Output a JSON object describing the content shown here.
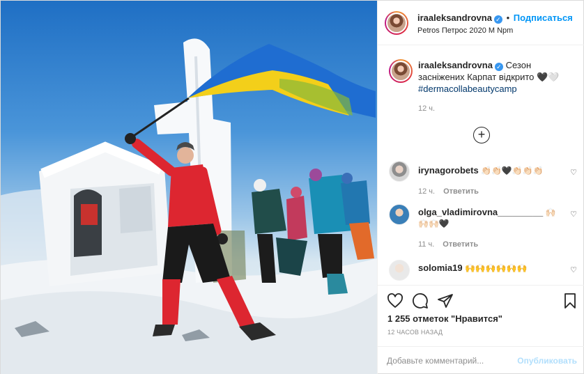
{
  "header": {
    "username": "iraaleksandrovna",
    "dot": "•",
    "follow_label": "Подписаться",
    "location": "Petros Петрос 2020 M Npm"
  },
  "caption": {
    "username": "iraaleksandrovna",
    "text": "Сезон засніжених Карпат відкрито 🖤🤍",
    "hashtag": "#dermacollabeautycamp",
    "age": "12 ч."
  },
  "comments": [
    {
      "username": "irynagorobets",
      "text": "👏🏻👏🏻🖤👏🏻👏🏻👏🏻",
      "age": "12 ч.",
      "reply": "Ответить"
    },
    {
      "username": "olga_vladimirovna_________",
      "text": "🙌🏻🙌🏻🙌🏻🖤",
      "age": "11 ч.",
      "reply": "Ответить"
    },
    {
      "username": "solomia19",
      "text": "🙌🙌🙌🙌🙌🙌"
    }
  ],
  "likes": "1 255 отметок \"Нравится\"",
  "timestamp": "12 ЧАСОВ НАЗАД",
  "add_comment_placeholder": "Добавьте комментарий...",
  "publish_label": "Опубликовать",
  "icons": {
    "load_more": "plus-circle-icon",
    "like": "heart-icon",
    "comment": "comment-icon",
    "share": "paper-plane-icon",
    "save": "bookmark-icon"
  }
}
